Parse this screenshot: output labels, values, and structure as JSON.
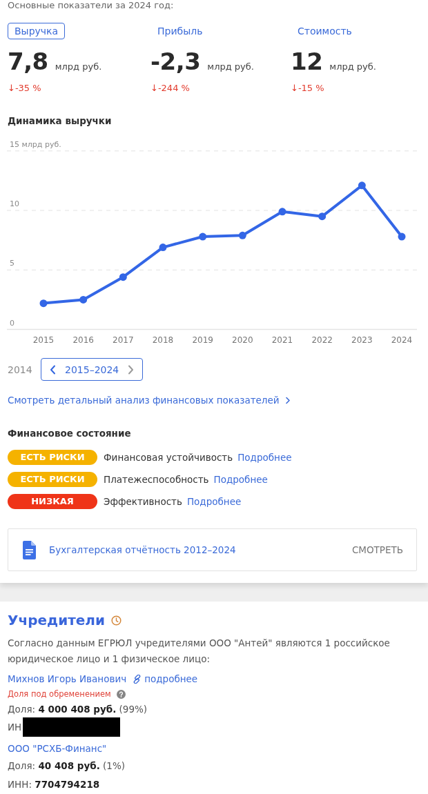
{
  "summary": {
    "heading": "Основные показатели за 2024 год:"
  },
  "metrics": [
    {
      "label": "Выручка",
      "selected": true,
      "value": "7,8",
      "unit": "млрд руб.",
      "change": "↓-35 %"
    },
    {
      "label": "Прибыль",
      "selected": false,
      "value": "-2,3",
      "unit": "млрд руб.",
      "change": "↓-244 %"
    },
    {
      "label": "Стоимость",
      "selected": false,
      "value": "12",
      "unit": "млрд руб.",
      "change": "↓-15 %"
    }
  ],
  "revenue_chart": {
    "chart_data": {
      "type": "line",
      "title": "Динамика выручки",
      "categories": [
        "2015",
        "2016",
        "2017",
        "2018",
        "2019",
        "2020",
        "2021",
        "2022",
        "2023",
        "2024"
      ],
      "values": [
        2.2,
        2.5,
        4.4,
        6.9,
        7.8,
        7.9,
        9.9,
        9.5,
        12.1,
        7.8
      ],
      "marker": true,
      "ylim": [
        0,
        15
      ],
      "yticks": [
        0,
        5,
        10,
        {
          "value": 15,
          "label": "15 млрд руб."
        }
      ]
    }
  },
  "period": {
    "previous": "2014",
    "current": "2015–2024",
    "next_disabled": true
  },
  "detail_link": "Смотреть детальный анализ финансовых показателей",
  "financial_state": {
    "title": "Финансовое состояние",
    "items": [
      {
        "badge": "ЕСТЬ РИСКИ",
        "color": "#f5b200",
        "name": "Финансовая устойчивость",
        "link": "Подробнее"
      },
      {
        "badge": "ЕСТЬ РИСКИ",
        "color": "#f5b200",
        "name": "Платежеспособность",
        "link": "Подробнее"
      },
      {
        "badge": "НИЗКАЯ",
        "color": "#ef3418",
        "name": "Эффективность",
        "link": "Подробнее"
      }
    ]
  },
  "reports_card": {
    "title": "Бухгалтерская отчётность 2012–2024",
    "action": "СМОТРЕТЬ"
  },
  "founders": {
    "title": "Учредители",
    "description": "Согласно данным ЕГРЮЛ учредителями ООО \"Антей\" являются 1 российское юридическое лицо и 1 физическое лицо:",
    "items": [
      {
        "name": "Михнов Игорь Иванович",
        "link": "подробнее",
        "encumbrance": "Доля под обременением",
        "share": "Доля: **4 000 408 руб.** (99%)",
        "inn": "ИН",
        "inn_redacted": true
      },
      {
        "name": "ООО \"РСХБ-Финанс\"",
        "share": "Доля: **40 408 руб.** (1%)",
        "inn": "ИНН: **7704794218**",
        "inn_redacted": false
      }
    ]
  }
}
